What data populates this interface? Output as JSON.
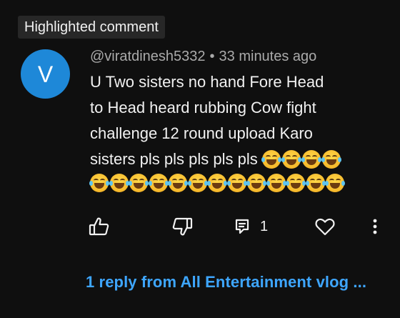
{
  "badge": {
    "label": "Highlighted comment"
  },
  "comment": {
    "avatar_letter": "V",
    "author": "@viratdinesh5332",
    "separator": "•",
    "time_ago": "33 minutes ago",
    "lines": [
      "U Two sisters no hand Fore Head",
      "to Head heard rubbing Cow fight",
      "challenge 12 round upload Karo",
      "sisters pls pls pls pls pls "
    ],
    "emoji": {
      "name": "face-with-tears-of-joy",
      "inline_count": 4,
      "row_count": 13
    }
  },
  "actions": {
    "like_icon": "thumbs-up-icon",
    "dislike_icon": "thumbs-down-icon",
    "reply_icon": "reply-icon",
    "reply_count": "1",
    "heart_icon": "heart-icon",
    "more_icon": "more-vert-icon"
  },
  "replies_link": {
    "label": "1 reply from All Entertainment  vlog ..."
  },
  "colors": {
    "background": "#0f0f0f",
    "badge_bg": "#272727",
    "avatar": "#1e88d8",
    "meta_text": "#aaaaaa",
    "link": "#3ea6ff"
  }
}
